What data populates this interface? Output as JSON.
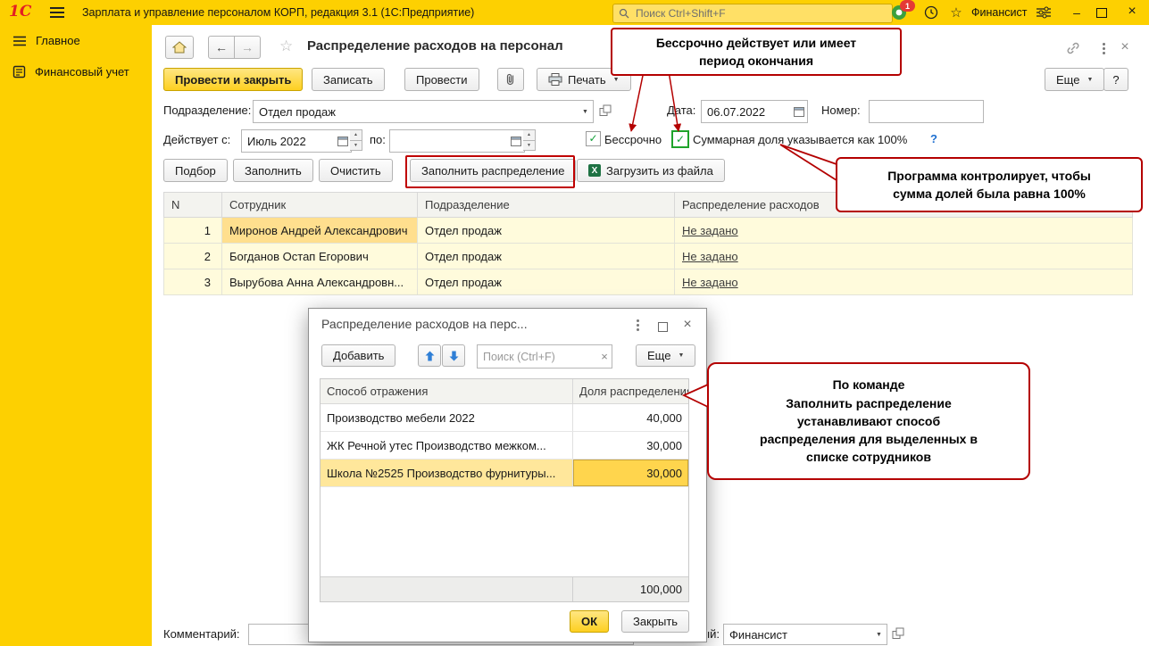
{
  "titlebar": {
    "logo": "1С",
    "app_title": "Зарплата и управление персоналом КОРП, редакция 3.1  (1С:Предприятие)",
    "search_placeholder": "Поиск Ctrl+Shift+F",
    "badge": "1",
    "user": "Финансист"
  },
  "sidebar": {
    "items": [
      {
        "label": "Главное"
      },
      {
        "label": "Финансовый учет"
      }
    ]
  },
  "doc": {
    "title": "Распределение расходов на персонал",
    "btn_post_close": "Провести и закрыть",
    "btn_save": "Записать",
    "btn_post": "Провести",
    "btn_print": "Печать",
    "btn_more": "Еще",
    "btn_help": "?",
    "lbl_department": "Подразделение:",
    "val_department": "Отдел продаж",
    "lbl_date": "Дата:",
    "val_date": "06.07.2022",
    "lbl_number": "Номер:",
    "lbl_valid_from": "Действует с:",
    "val_valid_from": "Июль 2022",
    "lbl_valid_to": "по:",
    "chk_perpetual": "Бессрочно",
    "chk_total_share": "Суммарная доля указывается как 100%",
    "help_link": "?",
    "btn_pick": "Подбор",
    "btn_fill": "Заполнить",
    "btn_clear": "Очистить",
    "btn_fill_distribution": "Заполнить распределение",
    "btn_load_file": "Загрузить из файла",
    "table": {
      "col_n": "N",
      "col_employee": "Сотрудник",
      "col_department": "Подразделение",
      "col_distribution": "Распределение расходов",
      "rows": [
        {
          "n": "1",
          "employee": "Миронов Андрей Александрович",
          "department": "Отдел продаж",
          "distribution": "Не задано"
        },
        {
          "n": "2",
          "employee": "Богданов Остап Егорович",
          "department": "Отдел продаж",
          "distribution": "Не задано"
        },
        {
          "n": "3",
          "employee": "Вырубова Анна Александровн...",
          "department": "Отдел продаж",
          "distribution": "Не задано"
        }
      ]
    },
    "lbl_comment": "Комментарий:",
    "lbl_responsible": "Ответственный:",
    "val_responsible": "Финансист"
  },
  "dialog": {
    "title": "Распределение расходов на перс...",
    "btn_add": "Добавить",
    "search_placeholder": "Поиск (Ctrl+F)",
    "btn_more": "Еще",
    "col_method": "Способ отражения",
    "col_share": "Доля распределения",
    "rows": [
      {
        "method": "Производство мебели 2022",
        "share": "40,000"
      },
      {
        "method": "ЖК Речной утес Производство межком...",
        "share": "30,000"
      },
      {
        "method": "Школа №2525 Производство фурнитуры...",
        "share": "30,000"
      }
    ],
    "total": "100,000",
    "btn_ok": "ОК",
    "btn_close": "Закрыть"
  },
  "annotations": {
    "callout_perpetual": "Бессрочно действует или имеет\nпериод окончания",
    "callout_control": "Программа контролирует, чтобы\nсумма долей была равна 100%",
    "callout_fill": "По команде\nЗаполнить распределение\nустанавливают способ\nраспределения для выделенных в\nсписке сотрудников"
  },
  "colors": {
    "brand_yellow": "#fdd001",
    "annotation_red": "#b40000",
    "row_cream": "#fffbdc",
    "selection_yellow": "#ffdf8e"
  }
}
